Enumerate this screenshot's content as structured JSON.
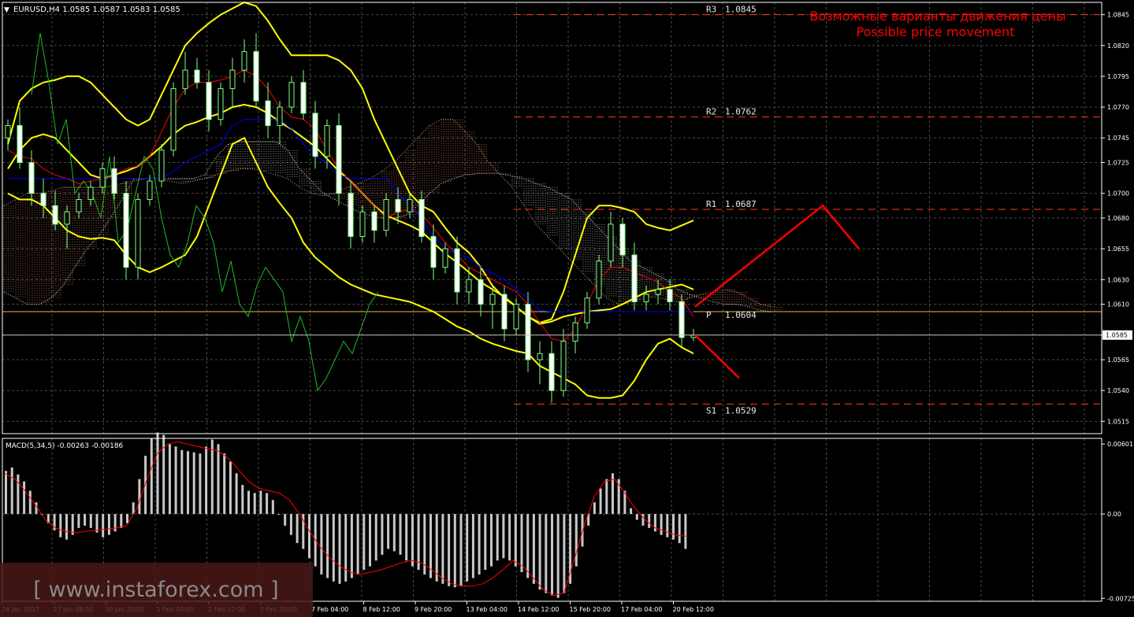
{
  "header": {
    "arrow": "▼",
    "symbol_line": "EURUSD,H4  1.0585 1.0587 1.0583 1.0585"
  },
  "annotation": {
    "line1": "Возможные варианты движения цены",
    "line2": "Possible price movement"
  },
  "watermark": "[ www.instaforex.com ]",
  "macd_label": "MACD(5,34,5) -0.00263 -0.00186",
  "colors": {
    "background": "#000000",
    "grid": "#4a4a4a",
    "axis": "#ffffff",
    "bollinger": "#ffff00",
    "tenkan": "#ff0000",
    "kijun": "#0000ff",
    "chikou": "#22bb22",
    "cloud_a": "#ffa07a",
    "cloud_b": "#e8e8e8",
    "level": "#ff3b1f",
    "pivot": "#e6c040",
    "forecast": "#ff0000",
    "annotation": "#ff0000",
    "macd_hist": "#c8c8c8",
    "macd_signal": "#ff0000",
    "watermark_bg": "#4a1818"
  },
  "chart_data": [
    {
      "type": "candlestick",
      "title": "EURUSD,H4",
      "ylim": [
        1.0505,
        1.0855
      ],
      "price_ticks": [
        "1.0845",
        "1.0820",
        "1.0795",
        "1.0770",
        "1.0745",
        "1.0725",
        "1.0700",
        "1.0680",
        "1.0655",
        "1.0630",
        "1.0610",
        "1.0585",
        "1.0565",
        "1.0540",
        "1.0515"
      ],
      "current_price": "1.0585",
      "x_labels": [
        "26 Jan 2017",
        "27 Jan 08:00",
        "30 Jan 20:00",
        "1 Feb 04:00",
        "2 Feb 12:00",
        "3 Feb 20:00",
        "7 Feb 04:00",
        "8 Feb 12:00",
        "9 Feb 20:00",
        "13 Feb 04:00",
        "14 Feb 12:00",
        "15 Feb 20:00",
        "17 Feb 04:00",
        "20 Feb 12:00"
      ],
      "levels": [
        {
          "label": "R3",
          "value": "1.0845"
        },
        {
          "label": "R2",
          "value": "1.0762"
        },
        {
          "label": "R1",
          "value": "1.0687"
        },
        {
          "label": "P",
          "value": "1.0604"
        },
        {
          "label": "S1",
          "value": "1.0529"
        }
      ],
      "forecast": [
        {
          "path": [
            1.0608,
            1.069,
            1.0655
          ]
        },
        {
          "path": [
            1.0585,
            1.055
          ]
        }
      ],
      "candles": [
        [
          1.0745,
          1.076,
          1.0735,
          1.0755
        ],
        [
          1.0755,
          1.077,
          1.072,
          1.0725
        ],
        [
          1.0725,
          1.0735,
          1.069,
          1.07
        ],
        [
          1.07,
          1.0712,
          1.068,
          1.069
        ],
        [
          1.069,
          1.0702,
          1.067,
          1.0675
        ],
        [
          1.0675,
          1.069,
          1.0655,
          1.0685
        ],
        [
          1.0685,
          1.07,
          1.068,
          1.0695
        ],
        [
          1.0695,
          1.071,
          1.069,
          1.0705
        ],
        [
          1.0705,
          1.0725,
          1.07,
          1.072
        ],
        [
          1.072,
          1.073,
          1.0695,
          1.07
        ],
        [
          1.07,
          1.071,
          1.063,
          1.064
        ],
        [
          1.064,
          1.07,
          1.063,
          1.0695
        ],
        [
          1.0695,
          1.0715,
          1.069,
          1.071
        ],
        [
          1.071,
          1.074,
          1.0705,
          1.0735
        ],
        [
          1.0735,
          1.079,
          1.073,
          1.0785
        ],
        [
          1.0785,
          1.0815,
          1.078,
          1.08
        ],
        [
          1.08,
          1.081,
          1.0785,
          1.079
        ],
        [
          1.079,
          1.08,
          1.075,
          1.076
        ],
        [
          1.076,
          1.079,
          1.0755,
          1.0785
        ],
        [
          1.0785,
          1.081,
          1.077,
          1.08
        ],
        [
          1.08,
          1.0825,
          1.079,
          1.0815
        ],
        [
          1.0815,
          1.083,
          1.077,
          1.0775
        ],
        [
          1.0775,
          1.079,
          1.0745,
          1.0755
        ],
        [
          1.0755,
          1.0775,
          1.074,
          1.077
        ],
        [
          1.077,
          1.0795,
          1.0765,
          1.079
        ],
        [
          1.079,
          1.08,
          1.076,
          1.0765
        ],
        [
          1.0765,
          1.0775,
          1.072,
          1.073
        ],
        [
          1.073,
          1.076,
          1.072,
          1.0755
        ],
        [
          1.0755,
          1.0765,
          1.069,
          1.07
        ],
        [
          1.07,
          1.071,
          1.0655,
          1.0665
        ],
        [
          1.0665,
          1.069,
          1.066,
          1.0685
        ],
        [
          1.0685,
          1.069,
          1.066,
          1.067
        ],
        [
          1.067,
          1.07,
          1.0665,
          1.0695
        ],
        [
          1.0695,
          1.0705,
          1.0675,
          1.0685
        ],
        [
          1.0685,
          1.07,
          1.068,
          1.0695
        ],
        [
          1.0695,
          1.0702,
          1.066,
          1.0665
        ],
        [
          1.0665,
          1.0675,
          1.063,
          1.064
        ],
        [
          1.064,
          1.066,
          1.0635,
          1.0655
        ],
        [
          1.0655,
          1.0665,
          1.061,
          1.062
        ],
        [
          1.062,
          1.064,
          1.061,
          1.063
        ],
        [
          1.063,
          1.064,
          1.06,
          1.061
        ],
        [
          1.061,
          1.0625,
          1.059,
          1.0618
        ],
        [
          1.0618,
          1.0625,
          1.058,
          1.059
        ],
        [
          1.059,
          1.0615,
          1.0585,
          1.061
        ],
        [
          1.061,
          1.062,
          1.0555,
          1.0565
        ],
        [
          1.0565,
          1.058,
          1.0545,
          1.057
        ],
        [
          1.057,
          1.058,
          1.053,
          1.054
        ],
        [
          1.054,
          1.059,
          1.0535,
          1.058
        ],
        [
          1.058,
          1.06,
          1.057,
          1.0595
        ],
        [
          1.0595,
          1.062,
          1.059,
          1.0615
        ],
        [
          1.0615,
          1.065,
          1.061,
          1.0645
        ],
        [
          1.0645,
          1.0685,
          1.064,
          1.0675
        ],
        [
          1.0675,
          1.068,
          1.064,
          1.065
        ],
        [
          1.065,
          1.066,
          1.0605,
          1.0612
        ],
        [
          1.0612,
          1.0625,
          1.0605,
          1.0618
        ],
        [
          1.0618,
          1.063,
          1.061,
          1.0622
        ],
        [
          1.0622,
          1.063,
          1.0605,
          1.0612
        ],
        [
          1.0612,
          1.0618,
          1.0575,
          1.0583
        ],
        [
          1.0583,
          1.059,
          1.058,
          1.0585
        ]
      ],
      "bollinger": {
        "upper": [
          1.074,
          1.0775,
          1.0785,
          1.079,
          1.0792,
          1.0795,
          1.0795,
          1.079,
          1.078,
          1.077,
          1.076,
          1.0755,
          1.076,
          1.078,
          1.08,
          1.082,
          1.083,
          1.0838,
          1.0845,
          1.085,
          1.0855,
          1.0852,
          1.084,
          1.0825,
          1.0812,
          1.0812,
          1.0812,
          1.0812,
          1.0808,
          1.08,
          1.0785,
          1.076,
          1.074,
          1.072,
          1.07,
          1.069,
          1.0685,
          1.0672,
          1.066,
          1.0652,
          1.064,
          1.0625,
          1.0615,
          1.0608,
          1.06,
          1.0595,
          1.0598,
          1.062,
          1.065,
          1.068,
          1.069,
          1.069,
          1.0688,
          1.0685,
          1.0675,
          1.0672,
          1.067,
          1.0674,
          1.0678
        ],
        "middle": [
          1.072,
          1.0735,
          1.0745,
          1.0748,
          1.0745,
          1.0735,
          1.0725,
          1.0715,
          1.0712,
          1.0715,
          1.0718,
          1.0722,
          1.073,
          1.0738,
          1.0748,
          1.0755,
          1.0758,
          1.0762,
          1.0765,
          1.077,
          1.0772,
          1.077,
          1.0765,
          1.0758,
          1.0752,
          1.0745,
          1.0738,
          1.0728,
          1.0718,
          1.071,
          1.07,
          1.069,
          1.0682,
          1.0678,
          1.0674,
          1.0669,
          1.066,
          1.0651,
          1.0644,
          1.0636,
          1.0628,
          1.0622,
          1.0616,
          1.0608,
          1.06,
          1.0594,
          1.0596,
          1.06,
          1.0602,
          1.0604,
          1.0605,
          1.0606,
          1.061,
          1.0615,
          1.062,
          1.0622,
          1.0624,
          1.0626,
          1.0622
        ],
        "lower": [
          1.07,
          1.0695,
          1.0695,
          1.069,
          1.068,
          1.067,
          1.0665,
          1.0663,
          1.0664,
          1.0662,
          1.065,
          1.064,
          1.0636,
          1.064,
          1.0645,
          1.065,
          1.0665,
          1.069,
          1.0715,
          1.074,
          1.0745,
          1.0725,
          1.0705,
          1.0692,
          1.068,
          1.066,
          1.0648,
          1.064,
          1.0632,
          1.0626,
          1.0622,
          1.0618,
          1.0616,
          1.0614,
          1.0612,
          1.0608,
          1.0604,
          1.0598,
          1.0592,
          1.0588,
          1.0582,
          1.0578,
          1.0575,
          1.0572,
          1.057,
          1.056,
          1.0555,
          1.055,
          1.0545,
          1.0536,
          1.0534,
          1.0534,
          1.0536,
          1.0548,
          1.0565,
          1.0578,
          1.0582,
          1.0575,
          1.057
        ]
      },
      "tenkan": [
        1.0735,
        1.073,
        1.0728,
        1.072,
        1.0715,
        1.0712,
        1.0708,
        1.071,
        1.0712,
        1.0715,
        1.072,
        1.0722,
        1.073,
        1.075,
        1.077,
        1.0785,
        1.079,
        1.079,
        1.0792,
        1.0795,
        1.08,
        1.0795,
        1.0785,
        1.077,
        1.0762,
        1.076,
        1.0752,
        1.0735,
        1.072,
        1.071,
        1.07,
        1.069,
        1.068,
        1.0685,
        1.0687,
        1.0683,
        1.0672,
        1.066,
        1.065,
        1.064,
        1.0635,
        1.063,
        1.0625,
        1.062,
        1.061,
        1.0595,
        1.0582,
        1.058,
        1.059,
        1.061,
        1.063,
        1.064,
        1.064,
        1.0636,
        1.0632,
        1.0628,
        1.062,
        1.0615,
        1.06
      ],
      "kijun": [
        1.0712,
        1.0712,
        1.0712,
        1.0712,
        1.0712,
        1.0712,
        1.0712,
        1.0712,
        1.0712,
        1.0712,
        1.0712,
        1.0712,
        1.0712,
        1.0712,
        1.0718,
        1.0725,
        1.073,
        1.0735,
        1.074,
        1.0755,
        1.076,
        1.076,
        1.076,
        1.076,
        1.0752,
        1.074,
        1.073,
        1.0725,
        1.0715,
        1.0712,
        1.0712,
        1.0712,
        1.0712,
        1.07,
        1.069,
        1.068,
        1.0665,
        1.0655,
        1.065,
        1.0648,
        1.064,
        1.0635,
        1.063,
        1.0622,
        1.0615,
        1.0605,
        1.0604,
        1.0604,
        1.0604,
        1.0604,
        1.0604,
        1.0604,
        1.0604,
        1.0604,
        1.0604,
        1.0604,
        1.0604,
        1.0604,
        1.0604
      ],
      "chikou": [
        1.078,
        1.083,
        1.079,
        1.074,
        1.076,
        1.07,
        1.071,
        1.07,
        1.068,
        1.073,
        1.066,
        1.067,
        1.07,
        1.073,
        1.072,
        1.068,
        1.065,
        1.064,
        1.066,
        1.069,
        1.068,
        1.066,
        1.062,
        1.0645,
        1.061,
        1.06,
        1.0625,
        1.064,
        1.063,
        1.062,
        1.058,
        1.06,
        1.058,
        1.054,
        1.055,
        1.0565,
        1.058,
        1.057,
        1.059,
        1.061,
        1.062
      ],
      "cloud": {
        "span_a": [
          1.069,
          1.0695,
          1.07,
          1.07,
          1.0702,
          1.0705,
          1.0705,
          1.0705,
          1.0705,
          1.0706,
          1.0708,
          1.071,
          1.0712,
          1.0712,
          1.071,
          1.0708,
          1.071,
          1.0712,
          1.0715,
          1.0718,
          1.072,
          1.072,
          1.0718,
          1.0715,
          1.0712,
          1.0705,
          1.07,
          1.0698,
          1.07,
          1.0705,
          1.0708,
          1.0712,
          1.0718,
          1.0725,
          1.0735,
          1.0745,
          1.0755,
          1.076,
          1.076,
          1.075,
          1.074,
          1.0725,
          1.0715,
          1.0705,
          1.069,
          1.0675,
          1.0665,
          1.0655,
          1.0645,
          1.0635,
          1.0625,
          1.0615,
          1.061,
          1.0612,
          1.0615,
          1.0616,
          1.0614,
          1.0612,
          1.0615,
          1.0618,
          1.062,
          1.0622,
          1.062,
          1.0615,
          1.061,
          1.0608
        ],
        "span_b": [
          1.062,
          1.0615,
          1.061,
          1.061,
          1.0615,
          1.0625,
          1.064,
          1.0655,
          1.0665,
          1.068,
          1.0695,
          1.0712,
          1.0712,
          1.0712,
          1.0712,
          1.0712,
          1.0712,
          1.0715,
          1.073,
          1.074,
          1.0742,
          1.0742,
          1.0742,
          1.0742,
          1.0735,
          1.072,
          1.071,
          1.07,
          1.0695,
          1.069,
          1.0685,
          1.0682,
          1.068,
          1.068,
          1.0682,
          1.069,
          1.07,
          1.0708,
          1.0712,
          1.0715,
          1.0716,
          1.0716,
          1.0716,
          1.0714,
          1.0712,
          1.0708,
          1.0705,
          1.07,
          1.0695,
          1.0685,
          1.0675,
          1.0665,
          1.0655,
          1.0645,
          1.064,
          1.0635,
          1.063,
          1.0622,
          1.0618,
          1.0615,
          1.0612,
          1.061,
          1.061,
          1.0608,
          1.0605,
          1.0604
        ]
      }
    },
    {
      "type": "bar",
      "title": "MACD(5,34,5)",
      "ylim": [
        -0.0075,
        0.0065
      ],
      "tick_labels": [
        "0.00601",
        "0.00",
        "-0.00725"
      ],
      "histogram": [
        0.0037,
        0.004,
        0.0034,
        0.0028,
        0.002,
        0.001,
        0.0,
        -0.0008,
        -0.0014,
        -0.002,
        -0.0022,
        -0.0018,
        -0.0012,
        -0.001,
        -0.0012,
        -0.0016,
        -0.002,
        -0.0018,
        -0.0015,
        -0.0012,
        -0.0008,
        0.001,
        0.003,
        0.005,
        0.0065,
        0.007,
        0.0068,
        0.006,
        0.0058,
        0.0055,
        0.0054,
        0.0053,
        0.0052,
        0.0058,
        0.0064,
        0.006,
        0.0052,
        0.0045,
        0.0035,
        0.0025,
        0.002,
        0.0018,
        0.002,
        0.0018,
        0.0012,
        0.0,
        -0.001,
        -0.0018,
        -0.0025,
        -0.003,
        -0.0038,
        -0.0045,
        -0.0052,
        -0.0055,
        -0.0058,
        -0.006,
        -0.0058,
        -0.0055,
        -0.0052,
        -0.0048,
        -0.0045,
        -0.004,
        -0.0035,
        -0.003,
        -0.0032,
        -0.0035,
        -0.004,
        -0.0045,
        -0.0048,
        -0.0052,
        -0.0055,
        -0.0058,
        -0.006,
        -0.0062,
        -0.0063,
        -0.0062,
        -0.0058,
        -0.0055,
        -0.0052,
        -0.0048,
        -0.0045,
        -0.004,
        -0.0038,
        -0.004,
        -0.0045,
        -0.005,
        -0.0055,
        -0.006,
        -0.0065,
        -0.0068,
        -0.007,
        -0.0072,
        -0.0068,
        -0.006,
        -0.0045,
        -0.0028,
        -0.001,
        0.001,
        0.0022,
        0.003,
        0.0035,
        0.003,
        0.002,
        0.0005,
        -0.0005,
        -0.001,
        -0.0012,
        -0.0015,
        -0.0018,
        -0.002,
        -0.0022,
        -0.0025,
        -0.003
      ],
      "signal": [
        0.0035,
        0.003,
        0.002,
        0.0008,
        -0.0005,
        -0.0012,
        -0.0015,
        -0.0016,
        -0.0015,
        -0.0014,
        -0.0013,
        -0.0012,
        -0.001,
        0.0005,
        0.003,
        0.0052,
        0.006,
        0.0062,
        0.006,
        0.0058,
        0.0056,
        0.0054,
        0.0048,
        0.0038,
        0.0028,
        0.0022,
        0.002,
        0.0018,
        0.0012,
        0.0,
        -0.0015,
        -0.0028,
        -0.0038,
        -0.0045,
        -0.005,
        -0.0052,
        -0.005,
        -0.0048,
        -0.0045,
        -0.0042,
        -0.004,
        -0.0042,
        -0.0048,
        -0.0055,
        -0.006,
        -0.0062,
        -0.0062,
        -0.006,
        -0.0055,
        -0.0048,
        -0.004,
        -0.0045,
        -0.0055,
        -0.0065,
        -0.007,
        -0.0068,
        -0.004,
        -0.001,
        0.0015,
        0.0028,
        0.003,
        0.0018,
        0.0005,
        -0.0005,
        -0.0012,
        -0.0015,
        -0.0018,
        -0.0019
      ]
    }
  ]
}
